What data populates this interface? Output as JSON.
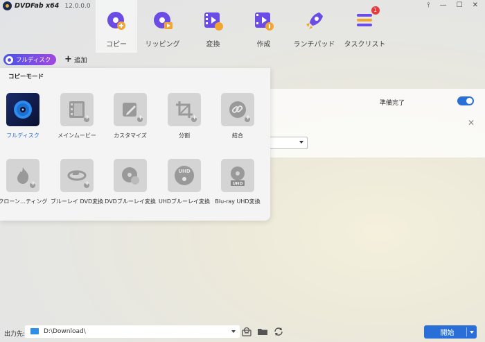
{
  "app": {
    "name": "DVDFab x64",
    "version": "12.0.0.0"
  },
  "window_controls": [
    "⫯",
    "—",
    "☐",
    "✕"
  ],
  "nav": [
    {
      "label": "コピー",
      "icon": "copy-disc-icon",
      "active": true
    },
    {
      "label": "リッピング",
      "icon": "ripping-icon",
      "active": false
    },
    {
      "label": "変換",
      "icon": "convert-icon",
      "active": false
    },
    {
      "label": "作成",
      "icon": "create-icon",
      "active": false
    },
    {
      "label": "ランチパッド",
      "icon": "rocket-icon",
      "active": false
    },
    {
      "label": "タスクリスト",
      "icon": "task-list-icon",
      "active": false,
      "badge": "1"
    }
  ],
  "subbar": {
    "mode": "フルディスク",
    "add": "追加"
  },
  "task": {
    "status": "準備完了",
    "select_value": "0"
  },
  "popup": {
    "title": "コピーモード",
    "modes": [
      {
        "label": "フルディスク",
        "icon": "full-disc-icon",
        "selected": true
      },
      {
        "label": "メインムービー",
        "icon": "film-icon"
      },
      {
        "label": "カスタマイズ",
        "icon": "edit-icon"
      },
      {
        "label": "分割",
        "icon": "crop-split-icon"
      },
      {
        "label": "結合",
        "icon": "merge-link-icon"
      },
      {
        "label": "クローン…ティング",
        "icon": "clone-flame-icon"
      },
      {
        "label": "ブルーレイ DVD変換",
        "icon": "bluray-to-dvd-icon"
      },
      {
        "label": "DVDブルーレイ変換",
        "icon": "dvd-to-bluray-icon"
      },
      {
        "label": "UHDブルーレイ変換",
        "icon": "uhd-to-bluray-icon"
      },
      {
        "label": "Blu-ray UHD変換",
        "icon": "bluray-to-uhd-icon"
      }
    ]
  },
  "bottom": {
    "output_label": "出力先:",
    "output_path": "D:\\Download\\",
    "start": "開始"
  },
  "colors": {
    "accent": "#2a6fd8",
    "badge": "#e8393d",
    "pill_start": "#4a55e8",
    "pill_end": "#a147e0"
  }
}
